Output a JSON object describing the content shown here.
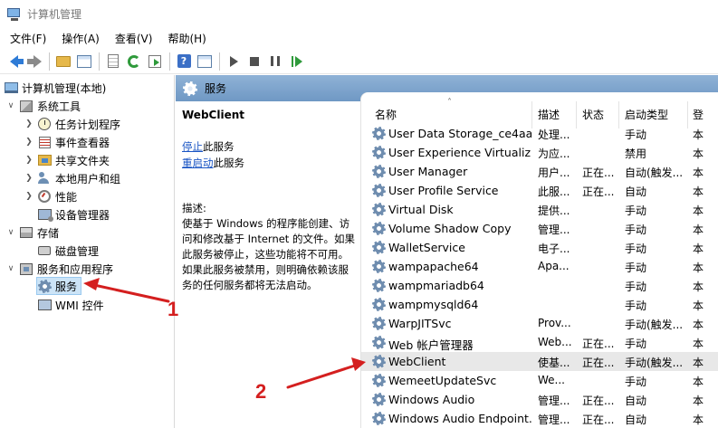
{
  "window": {
    "title": "计算机管理"
  },
  "menu": [
    "文件(F)",
    "操作(A)",
    "查看(V)",
    "帮助(H)"
  ],
  "toolbar": [
    "back-icon",
    "forward-icon",
    "folder-up-icon",
    "show-tree-icon",
    "properties-icon",
    "refresh-icon",
    "export-icon",
    "help-icon",
    "console-icon",
    "start-icon",
    "stop-icon",
    "pause-icon",
    "restart-icon"
  ],
  "tree": {
    "root": "计算机管理(本地)",
    "system_tools": "系统工具",
    "task_scheduler": "任务计划程序",
    "event_viewer": "事件查看器",
    "shared_folders": "共享文件夹",
    "local_users": "本地用户和组",
    "performance": "性能",
    "device_manager": "设备管理器",
    "storage": "存储",
    "disk_management": "磁盘管理",
    "services_apps": "服务和应用程序",
    "services": "服务",
    "wmi": "WMI 控件"
  },
  "header": {
    "title": "服务"
  },
  "description": {
    "service_name": "WebClient",
    "stop_link": "停止",
    "stop_suffix": "此服务",
    "restart_link": "重启动",
    "restart_suffix": "此服务",
    "label": "描述:",
    "lines": [
      "使基于 Windows 的程序能创建、访",
      "问和修改基于 Internet 的文件。如果",
      "此服务被停止，这些功能将不可用。",
      "如果此服务被禁用，则明确依赖该服",
      "务的任何服务都将无法启动。"
    ]
  },
  "columns": {
    "name": "名称",
    "desc": "描述",
    "status": "状态",
    "startup": "启动类型",
    "logon": "登"
  },
  "services": [
    {
      "name": "User Data Storage_ce4aa...",
      "desc": "处理...",
      "status": "",
      "startup": "手动",
      "logon": "本"
    },
    {
      "name": "User Experience Virtualiz...",
      "desc": "为应...",
      "status": "",
      "startup": "禁用",
      "logon": "本"
    },
    {
      "name": "User Manager",
      "desc": "用户...",
      "status": "正在...",
      "startup": "自动(触发...",
      "logon": "本"
    },
    {
      "name": "User Profile Service",
      "desc": "此服...",
      "status": "正在...",
      "startup": "自动",
      "logon": "本"
    },
    {
      "name": "Virtual Disk",
      "desc": "提供...",
      "status": "",
      "startup": "手动",
      "logon": "本"
    },
    {
      "name": "Volume Shadow Copy",
      "desc": "管理...",
      "status": "",
      "startup": "手动",
      "logon": "本"
    },
    {
      "name": "WalletService",
      "desc": "电子...",
      "status": "",
      "startup": "手动",
      "logon": "本"
    },
    {
      "name": "wampapache64",
      "desc": "Apa...",
      "status": "",
      "startup": "手动",
      "logon": "本"
    },
    {
      "name": "wampmariadb64",
      "desc": "",
      "status": "",
      "startup": "手动",
      "logon": "本"
    },
    {
      "name": "wampmysqld64",
      "desc": "",
      "status": "",
      "startup": "手动",
      "logon": "本"
    },
    {
      "name": "WarpJITSvc",
      "desc": "Prov...",
      "status": "",
      "startup": "手动(触发...",
      "logon": "本"
    },
    {
      "name": "Web 帐户管理器",
      "desc": "Web...",
      "status": "正在...",
      "startup": "手动",
      "logon": "本"
    },
    {
      "name": "WebClient",
      "desc": "使基...",
      "status": "正在...",
      "startup": "手动(触发...",
      "logon": "本"
    },
    {
      "name": "WemeetUpdateSvc",
      "desc": "We...",
      "status": "",
      "startup": "手动",
      "logon": "本"
    },
    {
      "name": "Windows Audio",
      "desc": "管理...",
      "status": "正在...",
      "startup": "自动",
      "logon": "本"
    },
    {
      "name": "Windows Audio Endpoint...",
      "desc": "管理...",
      "status": "正在...",
      "startup": "自动",
      "logon": "本"
    }
  ],
  "annotations": {
    "step1": "1",
    "step2": "2"
  },
  "colors": {
    "annotation": "#d41f1f",
    "header": "#7fa4cc",
    "link": "#1a55c4",
    "selection": "#cce4f7"
  }
}
